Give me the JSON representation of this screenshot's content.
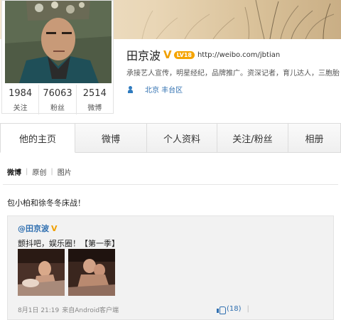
{
  "profile": {
    "name": "田京波",
    "verified_badge": "V",
    "level_badge": "LV18",
    "home_url": "http://weibo.com/jbtian",
    "bio": "承接艺人宣传，明星经纪，品牌推广。资深记者，育儿达人，三胞胎",
    "location": "北京 丰台区",
    "avatar_icon": "user-avatar-photo",
    "location_icon": "user-icon"
  },
  "stats": [
    {
      "value": "1984",
      "label": "关注"
    },
    {
      "value": "76063",
      "label": "粉丝"
    },
    {
      "value": "2514",
      "label": "微博"
    }
  ],
  "tabs": [
    {
      "label": "他的主页",
      "active": true
    },
    {
      "label": "微博"
    },
    {
      "label": "个人资料"
    },
    {
      "label": "关注/粉丝"
    },
    {
      "label": "相册"
    }
  ],
  "subtabs": [
    {
      "label": "微博",
      "active": true
    },
    {
      "label": "原创"
    },
    {
      "label": "图片"
    }
  ],
  "feed": {
    "post_text": "包小柏和徐冬冬床战！",
    "repost": {
      "author": "@田京波",
      "verified_badge": "V",
      "text": "颤抖吧，娱乐圈！【第一季】",
      "time": "8月1日 21:19",
      "source": "来自Android客户端",
      "likes": "(18)",
      "like_icon": "thumbs-up-icon",
      "meta_sep": "|"
    }
  },
  "colors": {
    "link": "#2f6fb0",
    "verified": "#f0a000",
    "tab_active_bg": "#ffffff",
    "page_bg": "#f3f3f3"
  }
}
